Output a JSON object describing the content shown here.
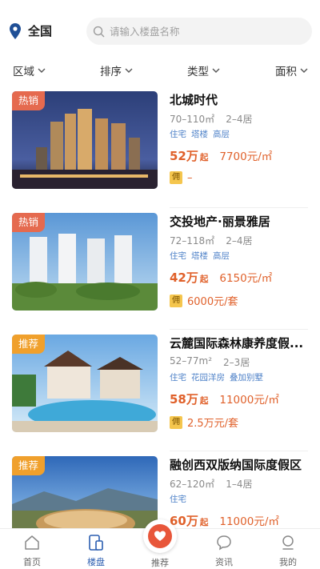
{
  "header": {
    "location": "全国",
    "search_placeholder": "请输入楼盘名称"
  },
  "filters": [
    {
      "label": "区域"
    },
    {
      "label": "排序"
    },
    {
      "label": "类型"
    },
    {
      "label": "面积"
    }
  ],
  "listings": [
    {
      "badge": "热销",
      "name": "北城时代",
      "area": "70–110㎡",
      "rooms": "2–4居",
      "tags": [
        "住宅",
        "塔楼",
        "高层"
      ],
      "total_price": "52万",
      "total_suffix": "起",
      "unit_price": "7700元/㎡",
      "commission_icon": "佣",
      "commission": "–"
    },
    {
      "badge": "热销",
      "name": "交投地产·丽景雅居",
      "area": "72–118㎡",
      "rooms": "2–4居",
      "tags": [
        "住宅",
        "塔楼",
        "高层"
      ],
      "total_price": "42万",
      "total_suffix": "起",
      "unit_price": "6150元/㎡",
      "commission_icon": "佣",
      "commission": "6000元/套"
    },
    {
      "badge": "推荐",
      "name": "云麓国际森林康养度假...",
      "area": "52–77m²",
      "rooms": "2–3居",
      "tags": [
        "住宅",
        "花园洋房",
        "叠加别墅"
      ],
      "total_price": "58万",
      "total_suffix": "起",
      "unit_price": "11000元/㎡",
      "commission_icon": "佣",
      "commission": "2.5万元/套"
    },
    {
      "badge": "推荐",
      "name": "融创西双版纳国际度假区",
      "area": "62–120㎡",
      "rooms": "1–4居",
      "tags": [
        "住宅"
      ],
      "total_price": "60万",
      "total_suffix": "起",
      "unit_price": "11000元/㎡",
      "commission_icon": "佣",
      "commission": ""
    }
  ],
  "tabbar": {
    "home": "首页",
    "buildings": "楼盘",
    "recommend": "推荐",
    "news": "资讯",
    "mine": "我的"
  },
  "colors": {
    "price": "#e0612b",
    "tag_text": "#4f82c8",
    "hot_badge": "#e56a4f",
    "recommend_badge": "#f0a02c",
    "active_tab": "#2a5db0",
    "commission_icon": "#f5c64e"
  }
}
